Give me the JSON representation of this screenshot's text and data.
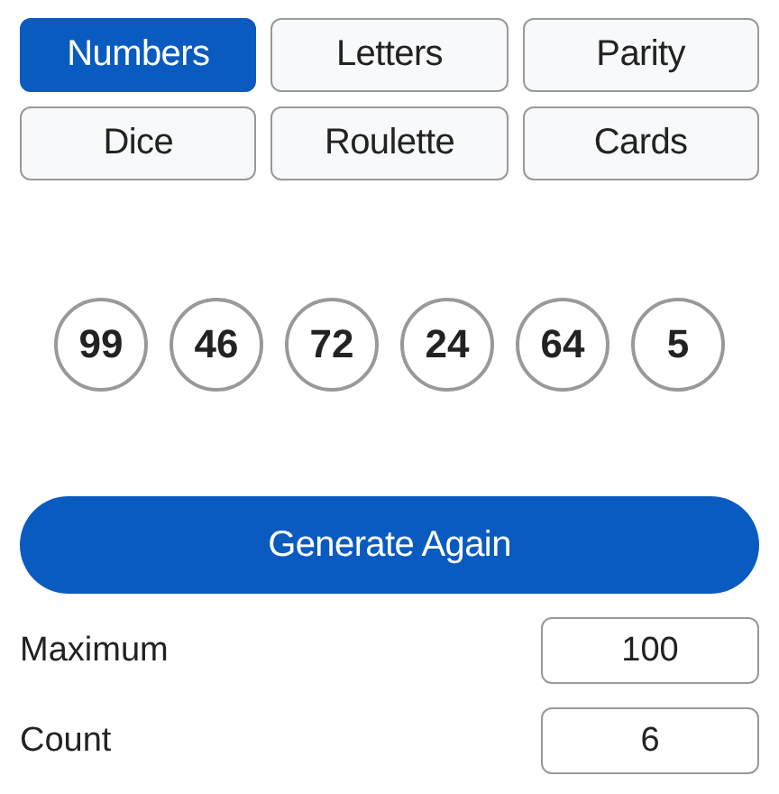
{
  "modes": [
    {
      "label": "Numbers",
      "selected": true
    },
    {
      "label": "Letters",
      "selected": false
    },
    {
      "label": "Parity",
      "selected": false
    },
    {
      "label": "Dice",
      "selected": false
    },
    {
      "label": "Roulette",
      "selected": false
    },
    {
      "label": "Cards",
      "selected": false
    }
  ],
  "results": [
    "99",
    "46",
    "72",
    "24",
    "64",
    "5"
  ],
  "generate_button": "Generate Again",
  "settings": [
    {
      "label": "Maximum",
      "value": "100"
    },
    {
      "label": "Count",
      "value": "6"
    }
  ]
}
